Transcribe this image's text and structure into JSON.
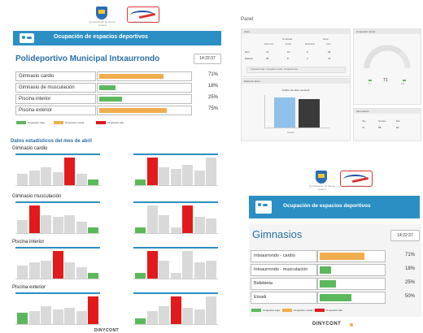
{
  "colors": {
    "accent": "#2b8fc4",
    "low": "#5cb85c",
    "medium": "#f0ad4e",
    "high": "#e31a1c",
    "bar_gray": "#d9d9d9",
    "panel_bar_blue": "#8fc1ea",
    "panel_bar_dark": "#3a3a3a"
  },
  "icons": {
    "municipal_logo": "shield-icon",
    "brand_logo": "brand-logo",
    "banner_icon": "people-icon"
  },
  "kiosk1": {
    "org_caption": "Ayuntamiento de Vitoria-Gasteiz",
    "brand_caption": "Diputación Foral",
    "banner_title": "Ocupación de espacios deportivos",
    "facility_title": "Polideportivo Municipal Intxaurrondo",
    "time": "14:22:37",
    "rows": [
      {
        "label": "Gimnasio cardio",
        "value": 71,
        "level": "medium",
        "pct": "71%"
      },
      {
        "label": "Gimnasio de musculación",
        "value": 18,
        "level": "low",
        "pct": "18%"
      },
      {
        "label": "Piscina interior",
        "value": 25,
        "level": "low",
        "pct": "25%"
      },
      {
        "label": "Piscina exterior",
        "value": 75,
        "level": "medium",
        "pct": "75%"
      }
    ],
    "legend": [
      "Ocupación baja",
      "Ocupación media",
      "Ocupación alta"
    ]
  },
  "dashboard": {
    "title": "Panel",
    "table_card": {
      "title": "Aforo",
      "group_headers": [
        "Ocupado",
        "Libre"
      ],
      "columns": [
        "Aforo max",
        "Actual",
        "Reservado",
        "Libre"
      ],
      "rows": [
        {
          "name": "Gim",
          "values": [
            "71",
            "12",
            "5",
            "29"
          ]
        },
        {
          "name": "Piscina",
          "values": [
            "25",
            "8",
            "2",
            "75"
          ]
        }
      ],
      "footer": "Ocupación baja · Ocupación media · Ocupación alta"
    },
    "gauge_card": {
      "title": "Ocupación actual",
      "value": "71",
      "min": "0",
      "max": "100",
      "gauge_fraction": 0.71
    },
    "bar_card": {
      "title": "Datos de aforo",
      "chart_title": "Gráfico de aforo semanal",
      "xlabel": "Fecha",
      "values": [
        92,
        88
      ]
    },
    "info_card": {
      "title": "Información",
      "labels": [
        "Hoy",
        "Semana",
        "Mes"
      ],
      "values": [
        "71",
        "58",
        "64"
      ]
    }
  },
  "stats": {
    "title": "Datos estadísticos del mes de abril",
    "sections": [
      "Gimnasio cardio",
      "Gimnasio musculación",
      "Piscina interior",
      "Piscina exterior"
    ],
    "chart_data": [
      {
        "type": "bar",
        "name": "Gimnasio cardio - día",
        "values": [
          40,
          50,
          60,
          45,
          95,
          40,
          20
        ],
        "highlight": 4,
        "low": 6
      },
      {
        "type": "bar",
        "name": "Gimnasio cardio - hora",
        "values": [
          20,
          95,
          60,
          55,
          70,
          50,
          95
        ],
        "highlight": 1,
        "low": 0
      },
      {
        "type": "bar",
        "name": "Gimnasio musculación - día",
        "values": [
          45,
          95,
          60,
          55,
          60,
          40,
          20
        ],
        "highlight": 1,
        "low": 6
      },
      {
        "type": "bar",
        "name": "Gimnasio musculación - hora",
        "values": [
          20,
          95,
          60,
          20,
          95,
          55,
          50
        ],
        "highlight": 4,
        "low": 0
      },
      {
        "type": "bar",
        "name": "Piscina interior - día",
        "values": [
          45,
          55,
          60,
          95,
          55,
          40,
          20
        ],
        "highlight": 3,
        "low": 6
      },
      {
        "type": "bar",
        "name": "Piscina interior - hora",
        "values": [
          20,
          95,
          60,
          20,
          95,
          55,
          60
        ],
        "highlight": 1,
        "low": 0
      },
      {
        "type": "bar",
        "name": "Piscina exterior - día",
        "values": [
          40,
          45,
          60,
          50,
          55,
          45,
          95
        ],
        "highlight": 6,
        "low": 0
      },
      {
        "type": "bar",
        "name": "Piscina exterior - hora",
        "values": [
          20,
          45,
          60,
          95,
          55,
          50,
          95
        ],
        "highlight": 3,
        "low": 0
      }
    ]
  },
  "kiosk2": {
    "org_caption": "Ayuntamiento de Vitoria-Gasteiz",
    "brand_caption": "Diputación Foral",
    "banner_title": "Ocupación de espacios deportivos",
    "facility_title": "Gimnasios",
    "time": "14:22:37",
    "rows": [
      {
        "label": "Intxaurrondo - cardio",
        "value": 71,
        "level": "medium",
        "pct": "71%"
      },
      {
        "label": "Intxaurrondo - musculación",
        "value": 18,
        "level": "low",
        "pct": "18%"
      },
      {
        "label": "Bidebieta",
        "value": 25,
        "level": "low",
        "pct": "25%"
      },
      {
        "label": "Etxadi",
        "value": 50,
        "level": "low",
        "pct": "50%"
      }
    ],
    "legend": [
      "Ocupación baja",
      "Ocupación media",
      "Ocupación alta"
    ]
  },
  "watermark": "DINYCONT"
}
